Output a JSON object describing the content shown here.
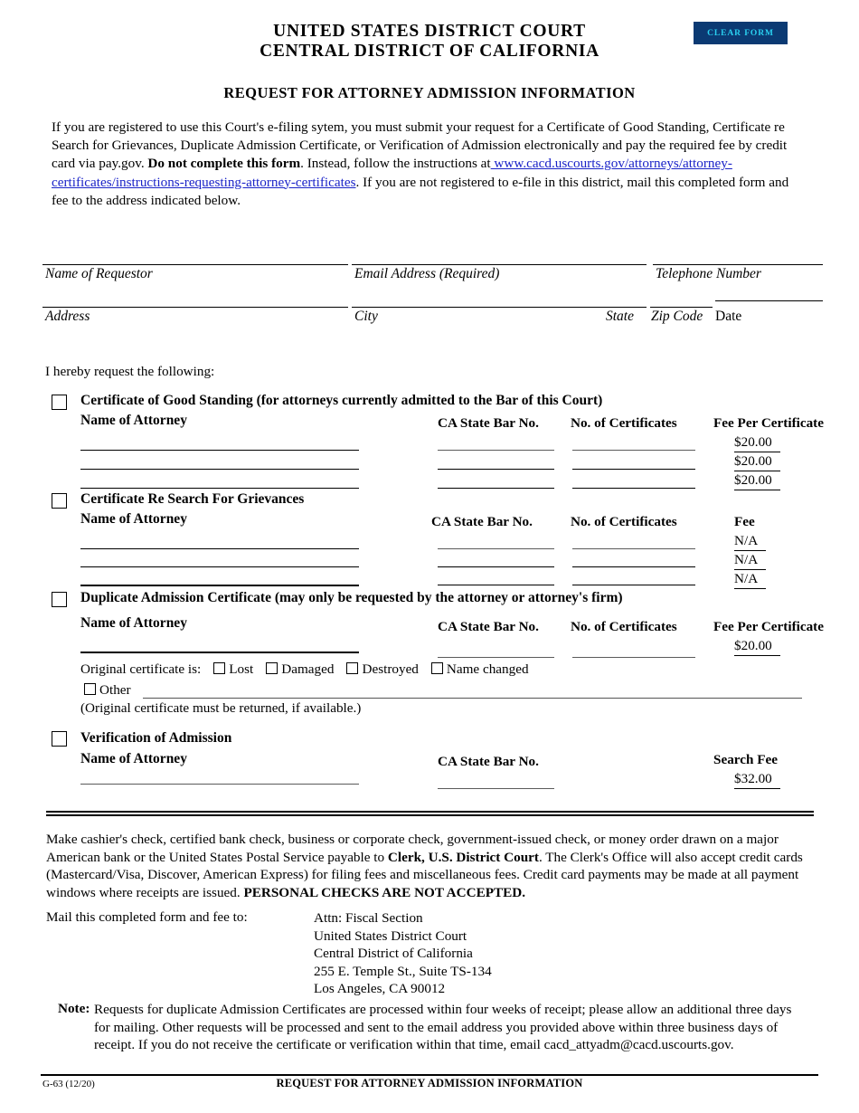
{
  "header": {
    "court_line1": "UNITED STATES DISTRICT COURT",
    "court_line2": "CENTRAL DISTRICT OF CALIFORNIA",
    "form_title": "REQUEST FOR ATTORNEY ADMISSION INFORMATION",
    "clear_form_label": "CLEAR FORM",
    "clear_form_bg": "#0b3a73",
    "clear_form_fg": "#2ad0f0"
  },
  "intro": {
    "part1": "If you are registered to use this Court's e-filing sytem, you must submit your request for a Certificate of Good Standing, Certificate re Search for Grievances, Duplicate Admission Certificate, or Verification of Admission electronically and pay the required fee by credit card via pay.gov.  ",
    "bold1": "Do not complete this form",
    "part2": ".  Instead, follow the instructions at",
    "link": " www.cacd.uscourts.gov/attorneys/attorney-certificates/instructions-requesting-attorney-certificates",
    "part3": ".  If you are not registered to e-file in this district, mail this completed form and fee to the address indicated below.",
    "link_color": "#1a23c8"
  },
  "requestor_fields": {
    "name": "Name of Requestor",
    "email": "Email Address (Required)",
    "telephone": "Telephone Number",
    "address": "Address",
    "city": "City",
    "state": "State",
    "zip": "Zip Code",
    "date": "Date"
  },
  "hereby_label": "I hereby request the following:",
  "sections": [
    {
      "id": "good-standing",
      "title": "Certificate of Good Standing (for attorneys currently admitted to the Bar of this Court)",
      "name_label": "Name of Attorney",
      "col_bar": "CA State Bar No.",
      "col_certs": "No. of Certificates",
      "col_fee": "Fee Per Certificate",
      "fees": [
        "$20.00",
        "$20.00",
        "$20.00"
      ]
    },
    {
      "id": "grievances",
      "title": "Certificate Re Search For Grievances",
      "name_label": "Name of Attorney",
      "col_bar": "CA State Bar No.",
      "col_certs": "No. of Certificates",
      "col_fee": "Fee",
      "fees": [
        "N/A",
        "N/A",
        "N/A"
      ]
    },
    {
      "id": "duplicate",
      "title": "Duplicate Admission Certificate (may only be requested by the attorney or attorney's firm)",
      "name_label": "Name of Attorney",
      "col_bar": "CA State Bar No.",
      "col_certs": "No. of Certificates",
      "col_fee": "Fee Per Certificate",
      "fees": [
        "$20.00"
      ],
      "original_prompt": "Original certificate is:",
      "options": [
        "Lost",
        "Damaged",
        "Destroyed",
        "Name changed"
      ],
      "other_label": "Other",
      "return_note": "(Original certificate must be returned, if available.)"
    },
    {
      "id": "verification",
      "title": "Verification of Admission",
      "name_label": "Name of Attorney",
      "col_bar": "CA State Bar No.",
      "col_fee": "Search Fee",
      "fees": [
        "$32.00"
      ]
    }
  ],
  "payment": {
    "part1": "Make cashier's check, certified bank check, business or corporate check, government-issued check, or money order drawn on a major American bank or the United States Postal Service payable to ",
    "bold1": "Clerk, U.S. District Court",
    "part2": ".  The Clerk's Office will also accept credit cards (Mastercard/Visa, Discover, American Express) for filing fees and miscellaneous fees.  Credit card payments may be made at all payment windows where receipts are issued.  ",
    "bold2": "PERSONAL CHECKS ARE NOT ACCEPTED."
  },
  "mail": {
    "label": "Mail this completed form and fee to:",
    "address_lines": [
      "Attn:  Fiscal Section",
      "United States District Court",
      "Central District of California",
      "255 E. Temple St., Suite TS-134",
      "Los Angeles, CA 90012"
    ]
  },
  "note": {
    "label": "Note:",
    "body": "Requests for duplicate Admission Certificates are processed within four weeks of receipt; please allow an additional three days for mailing.  Other requests will be processed and sent to the email address you provided above within three business days of receipt.  If you do not receive the certificate or verification within that time, email cacd_attyadm@cacd.uscourts.gov."
  },
  "footer": {
    "form_number": "G-63 (12/20)",
    "title": "REQUEST FOR  ATTORNEY ADMISSION INFORMATION"
  }
}
